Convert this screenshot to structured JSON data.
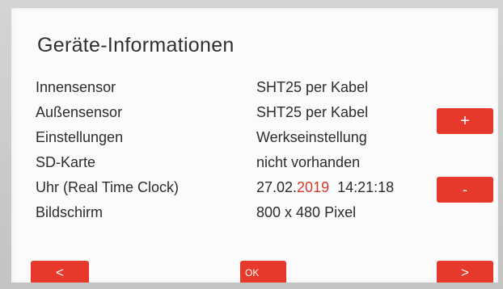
{
  "title": "Geräte-Informationen",
  "rows": [
    {
      "label": "Innensensor",
      "value": "SHT25 per Kabel"
    },
    {
      "label": "Außensensor",
      "value": "SHT25 per Kabel"
    },
    {
      "label": "Einstellungen",
      "value": "Werkseinstellung"
    },
    {
      "label": "SD-Karte",
      "value": "nicht vorhanden"
    },
    {
      "label": "Uhr (Real Time Clock)",
      "value_date_prefix": "27.02.",
      "value_year": "2019",
      "value_time": "14:21:18"
    },
    {
      "label": "Bildschirm",
      "value": "800 x 480 Pixel"
    }
  ],
  "buttons": {
    "plus": "+",
    "minus": "-",
    "prev": "<",
    "ok": "OK",
    "next": ">"
  },
  "colors": {
    "button": "#e6382b",
    "year_highlight": "#d03a2a",
    "screen_background": "#fbfbfb",
    "text": "#2c2c2c"
  }
}
